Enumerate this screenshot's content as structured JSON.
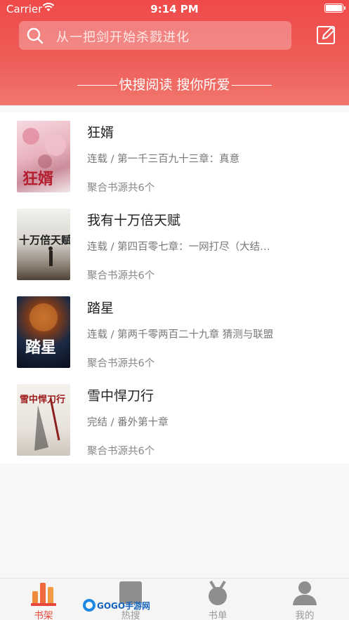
{
  "status_bar": {
    "carrier": "Carrier",
    "time": "9:14 PM"
  },
  "search": {
    "placeholder": "从一把剑开始杀戮进化",
    "icon": "search-icon"
  },
  "header": {
    "edit_icon": "edit-icon",
    "slogan": "快搜阅读 搜你所爱"
  },
  "books": [
    {
      "title": "狂婿",
      "chapter": "连载 / 第一千三百九十三章：真意",
      "source": "聚合书源共6个",
      "cover_text": "狂婿"
    },
    {
      "title": "我有十万倍天赋",
      "chapter": "连载 / 第四百零七章：一网打尽（大结…",
      "source": "聚合书源共6个",
      "cover_text": "十万倍天赋"
    },
    {
      "title": "踏星",
      "chapter": "连载 / 第两千零两百二十九章 猜测与联盟",
      "source": "聚合书源共6个",
      "cover_text": "踏星"
    },
    {
      "title": "雪中悍刀行",
      "chapter": "完结 / 番外第十章",
      "source": "聚合书源共6个",
      "cover_text": "雪中悍刀行"
    }
  ],
  "tabbar": {
    "tabs": [
      {
        "label": "书架",
        "icon": "bookshelf-icon",
        "active": true
      },
      {
        "label": "热搜",
        "icon": "hot-search-icon",
        "active": false
      },
      {
        "label": "书单",
        "icon": "medal-icon",
        "active": false
      },
      {
        "label": "我的",
        "icon": "user-icon",
        "active": false
      }
    ]
  },
  "watermark": "GOGO手游网",
  "colors": {
    "accent": "#e8483c",
    "header_top": "#ef4a4a",
    "header_bottom": "#f0776d"
  }
}
